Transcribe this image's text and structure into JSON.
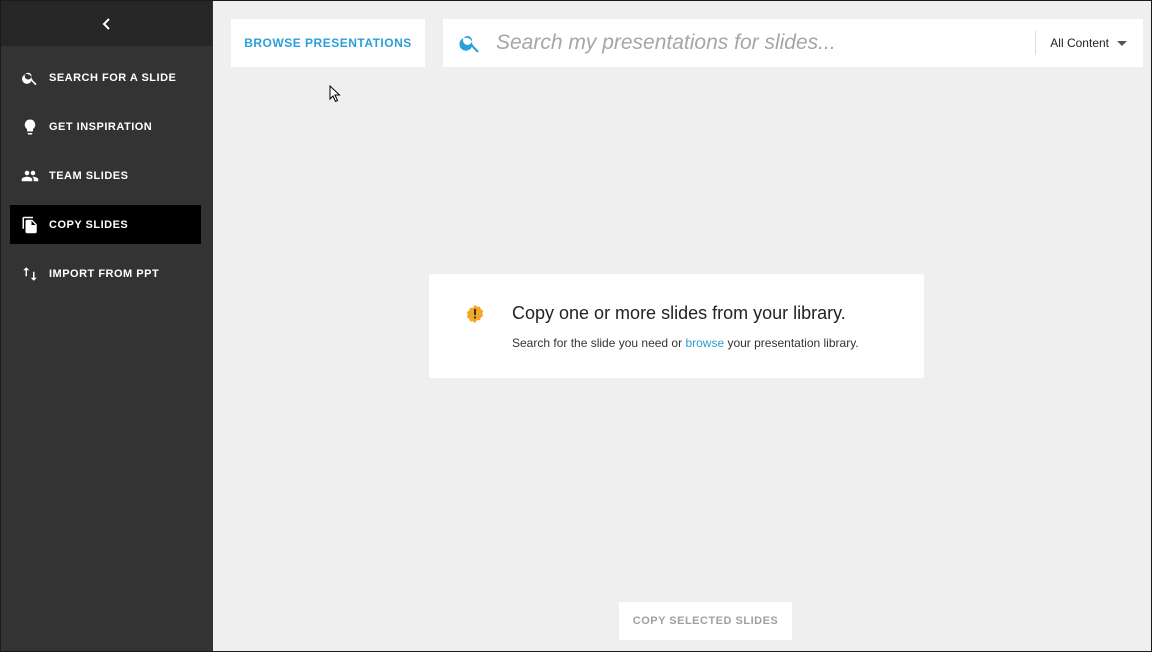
{
  "sidebar": {
    "collapse_icon": "chevron-left-icon",
    "items": [
      {
        "label": "Search for a slide",
        "icon": "search-icon"
      },
      {
        "label": "Get inspiration",
        "icon": "lightbulb-icon"
      },
      {
        "label": "Team slides",
        "icon": "people-icon"
      },
      {
        "label": "Copy slides",
        "icon": "copy-icon",
        "active": true
      },
      {
        "label": "Import from PPT",
        "icon": "import-arrows-icon"
      }
    ]
  },
  "toolbar": {
    "browse_label": "Browse Presentations",
    "search_placeholder": "Search my presentations for slides...",
    "filter_selected": "All Content"
  },
  "info": {
    "title": "Copy one or more slides from your library.",
    "text_before": "Search for the slide you need or ",
    "link": "browse",
    "text_after": " your presentation library."
  },
  "footer": {
    "copy_selected_label": "Copy selected slides"
  },
  "colors": {
    "accent": "#2a9fd8",
    "warning": "#f5a623",
    "sidebar_bg": "#333333",
    "main_bg": "#efefef"
  }
}
